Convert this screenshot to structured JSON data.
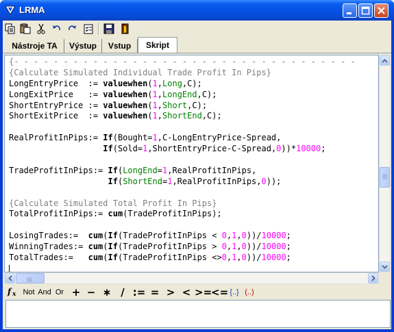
{
  "window": {
    "title": "LRMA",
    "controls": [
      "minimize",
      "maximize",
      "close"
    ]
  },
  "toolbar": {
    "buttons": [
      {
        "name": "copy-icon"
      },
      {
        "name": "paste-icon"
      },
      {
        "name": "cut-icon"
      },
      {
        "name": "undo-icon"
      },
      {
        "name": "redo-icon"
      },
      {
        "name": "properties-icon"
      },
      {
        "name": "save-icon"
      },
      {
        "name": "exit-icon"
      }
    ]
  },
  "tabs": [
    {
      "label": "Nástroje TA",
      "active": false
    },
    {
      "label": "Výstup",
      "active": false
    },
    {
      "label": "Vstup",
      "active": false
    },
    {
      "label": "Skript",
      "active": true
    }
  ],
  "editor": {
    "lines": [
      [
        {
          "t": "{- - - - - - - - - - - - - - - - - - - - - - - - - - - - - - - - - - -",
          "c": "comment"
        }
      ],
      [
        {
          "t": "{Calculate Simulated Individual Trade Profit In Pips}",
          "c": "comment"
        }
      ],
      [
        {
          "t": "LongEntryPrice  := "
        },
        {
          "t": "valuewhen",
          "c": "kw"
        },
        {
          "t": "("
        },
        {
          "t": "1",
          "c": "num"
        },
        {
          "t": ","
        },
        {
          "t": "Long",
          "c": "green"
        },
        {
          "t": ",C);"
        }
      ],
      [
        {
          "t": "LongExitPrice   := "
        },
        {
          "t": "valuewhen",
          "c": "kw"
        },
        {
          "t": "("
        },
        {
          "t": "1",
          "c": "num"
        },
        {
          "t": ","
        },
        {
          "t": "LongEnd",
          "c": "green"
        },
        {
          "t": ",C);"
        }
      ],
      [
        {
          "t": "ShortEntryPrice := "
        },
        {
          "t": "valuewhen",
          "c": "kw"
        },
        {
          "t": "("
        },
        {
          "t": "1",
          "c": "num"
        },
        {
          "t": ","
        },
        {
          "t": "Short",
          "c": "green"
        },
        {
          "t": ",C);"
        }
      ],
      [
        {
          "t": "ShortExitPrice  := "
        },
        {
          "t": "valuewhen",
          "c": "kw"
        },
        {
          "t": "("
        },
        {
          "t": "1",
          "c": "num"
        },
        {
          "t": ","
        },
        {
          "t": "ShortEnd",
          "c": "green"
        },
        {
          "t": ",C);"
        }
      ],
      [
        {
          "t": ""
        }
      ],
      [
        {
          "t": "RealProfitInPips:= "
        },
        {
          "t": "If",
          "c": "kw"
        },
        {
          "t": "(Bought="
        },
        {
          "t": "1",
          "c": "num"
        },
        {
          "t": ",C-LongEntryPrice-Spread,"
        }
      ],
      [
        {
          "t": "                   "
        },
        {
          "t": "If",
          "c": "kw"
        },
        {
          "t": "(Sold="
        },
        {
          "t": "1",
          "c": "num"
        },
        {
          "t": ",ShortEntryPrice-C-Spread,"
        },
        {
          "t": "0",
          "c": "num"
        },
        {
          "t": "))*"
        },
        {
          "t": "10000",
          "c": "num"
        },
        {
          "t": ";"
        }
      ],
      [
        {
          "t": ""
        }
      ],
      [
        {
          "t": "TradeProfitInPips:= "
        },
        {
          "t": "If",
          "c": "kw"
        },
        {
          "t": "("
        },
        {
          "t": "LongEnd",
          "c": "green"
        },
        {
          "t": "="
        },
        {
          "t": "1",
          "c": "num"
        },
        {
          "t": ",RealProfitInPips,"
        }
      ],
      [
        {
          "t": "                    "
        },
        {
          "t": "If",
          "c": "kw"
        },
        {
          "t": "("
        },
        {
          "t": "ShortEnd",
          "c": "green"
        },
        {
          "t": "="
        },
        {
          "t": "1",
          "c": "num"
        },
        {
          "t": ",RealProfitInPips,"
        },
        {
          "t": "0",
          "c": "num"
        },
        {
          "t": "));"
        }
      ],
      [
        {
          "t": ""
        }
      ],
      [
        {
          "t": "{Calculate Simulated Total Profit In Pips}",
          "c": "comment"
        }
      ],
      [
        {
          "t": "TotalProfitInPips:= "
        },
        {
          "t": "cum",
          "c": "kw"
        },
        {
          "t": "(TradeProfitInPips);"
        }
      ],
      [
        {
          "t": ""
        }
      ],
      [
        {
          "t": "LosingTrades:=  "
        },
        {
          "t": "cum",
          "c": "kw"
        },
        {
          "t": "("
        },
        {
          "t": "If",
          "c": "kw"
        },
        {
          "t": "(TradeProfitInPips < "
        },
        {
          "t": "0",
          "c": "num"
        },
        {
          "t": ","
        },
        {
          "t": "1",
          "c": "num"
        },
        {
          "t": ","
        },
        {
          "t": "0",
          "c": "num"
        },
        {
          "t": "))/"
        },
        {
          "t": "10000",
          "c": "num"
        },
        {
          "t": ";"
        }
      ],
      [
        {
          "t": "WinningTrades:= "
        },
        {
          "t": "cum",
          "c": "kw"
        },
        {
          "t": "("
        },
        {
          "t": "If",
          "c": "kw"
        },
        {
          "t": "(TradeProfitInPips > "
        },
        {
          "t": "0",
          "c": "num"
        },
        {
          "t": ","
        },
        {
          "t": "1",
          "c": "num"
        },
        {
          "t": ","
        },
        {
          "t": "0",
          "c": "num"
        },
        {
          "t": "))/"
        },
        {
          "t": "10000",
          "c": "num"
        },
        {
          "t": ";"
        }
      ],
      [
        {
          "t": "TotalTrades:=   "
        },
        {
          "t": "cum",
          "c": "kw"
        },
        {
          "t": "("
        },
        {
          "t": "If",
          "c": "kw"
        },
        {
          "t": "(TradeProfitInPips <>"
        },
        {
          "t": "0",
          "c": "num"
        },
        {
          "t": ","
        },
        {
          "t": "1",
          "c": "num"
        },
        {
          "t": ","
        },
        {
          "t": "0",
          "c": "num"
        },
        {
          "t": "))/"
        },
        {
          "t": "10000",
          "c": "num"
        },
        {
          "t": ";"
        }
      ]
    ]
  },
  "function_bar": {
    "fx_icon": "function-icon",
    "buttons": [
      {
        "label": "Not",
        "name": "not-button"
      },
      {
        "label": "And",
        "name": "and-button"
      },
      {
        "label": "Or",
        "name": "or-button"
      },
      {
        "label": "+",
        "name": "plus-button"
      },
      {
        "label": "−",
        "name": "minus-button"
      },
      {
        "label": "∗",
        "name": "multiply-button"
      },
      {
        "label": "/",
        "name": "divide-button"
      },
      {
        "label": ":=",
        "name": "assign-button"
      },
      {
        "label": "=",
        "name": "equals-button"
      },
      {
        "label": ">",
        "name": "greater-button"
      },
      {
        "label": "<",
        "name": "less-button"
      },
      {
        "label": ">=",
        "name": "greater-equal-button"
      },
      {
        "label": "<=",
        "name": "less-equal-button"
      },
      {
        "label": "{..}",
        "name": "comment-brace-button"
      },
      {
        "label": "(..)",
        "name": "parentheses-button"
      }
    ]
  },
  "expression_box": {
    "value": ""
  },
  "colors": {
    "title_bar": "#0551E3",
    "comment": "#808080",
    "number": "#FF00FF",
    "identifier_green": "#008000",
    "face": "#ECE9D8"
  }
}
